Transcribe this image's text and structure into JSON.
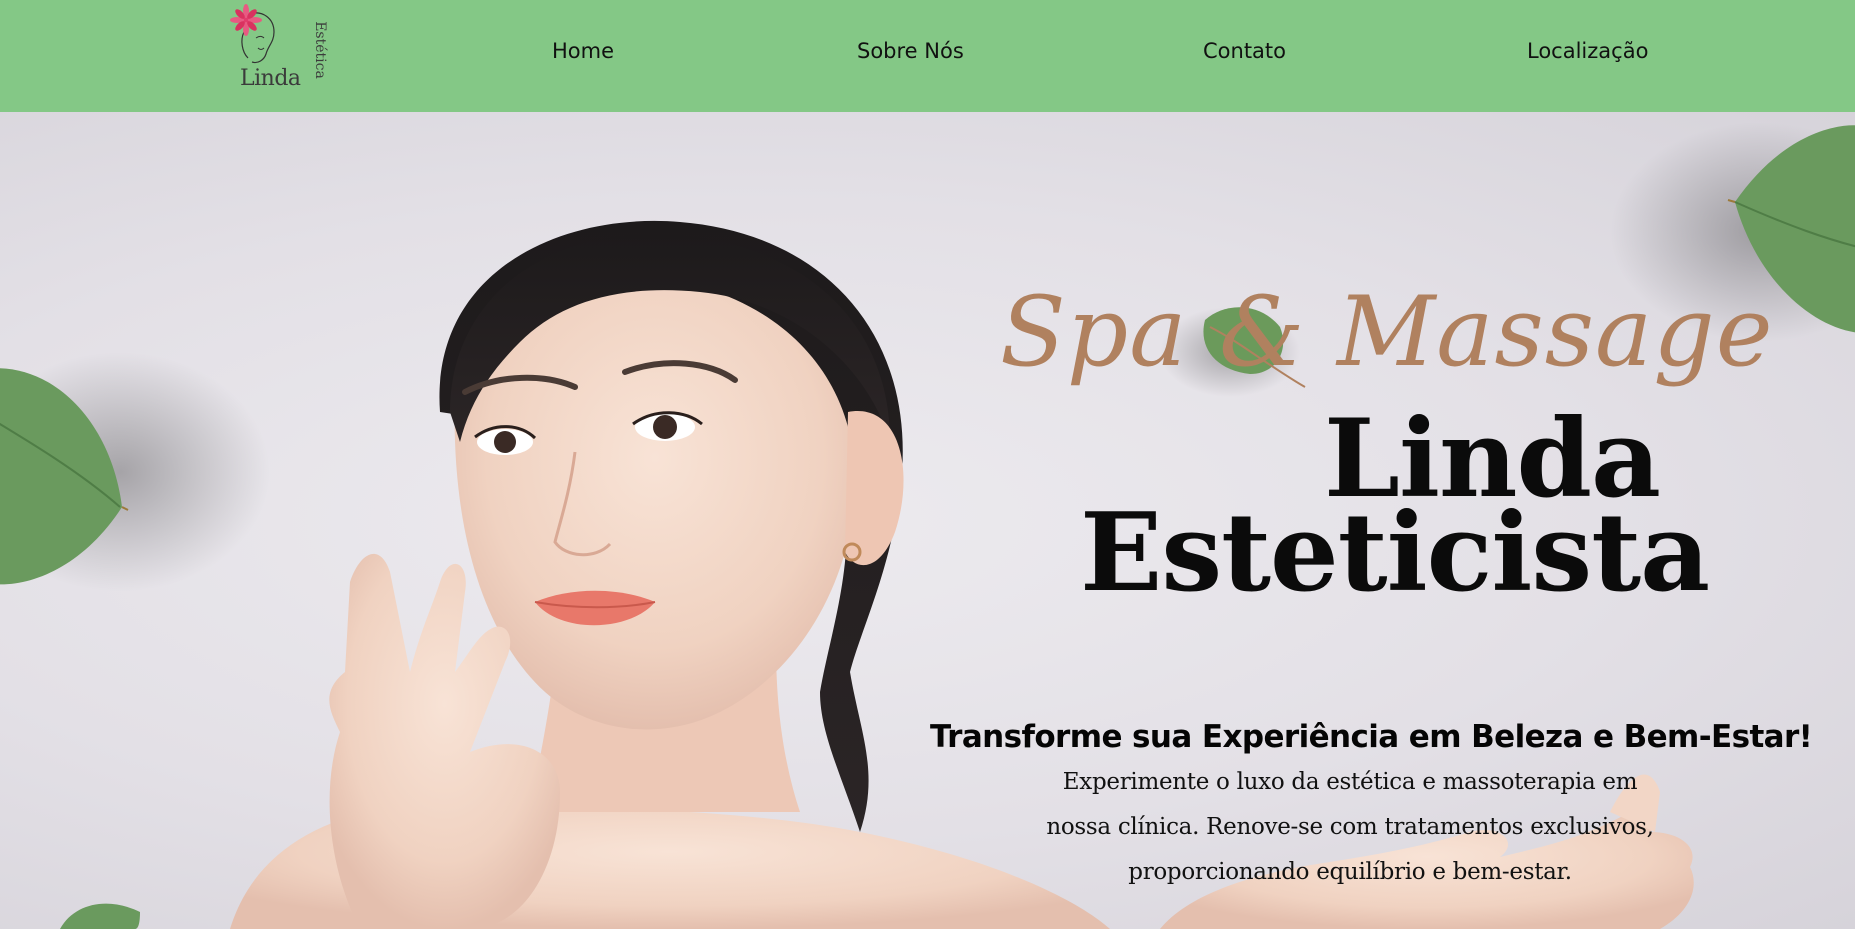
{
  "header": {
    "logo": {
      "name": "Linda",
      "subtitle": "Estética"
    },
    "nav": [
      {
        "label": "Home"
      },
      {
        "label": "Sobre Nós"
      },
      {
        "label": "Contato"
      },
      {
        "label": "Localização"
      }
    ]
  },
  "hero": {
    "script_title": "Spa & Massage",
    "brand_line1": "Linda",
    "brand_line2": "Esteticista",
    "headline": "Transforme sua Experiência em Beleza e Bem-Estar!",
    "paragraph_lines": [
      "Experimente o luxo da estética e massoterapia em",
      "nossa clínica. Renove-se com tratamentos exclusivos,",
      "proporcionando equilíbrio e bem-estar."
    ]
  },
  "colors": {
    "nav_background": "#84c886",
    "script_accent": "#b0815f",
    "leaf_green": "#6a9a5e",
    "logo_flower": "#e23d6c"
  },
  "icons": [
    "flower-logo-icon",
    "leaf-icon"
  ]
}
